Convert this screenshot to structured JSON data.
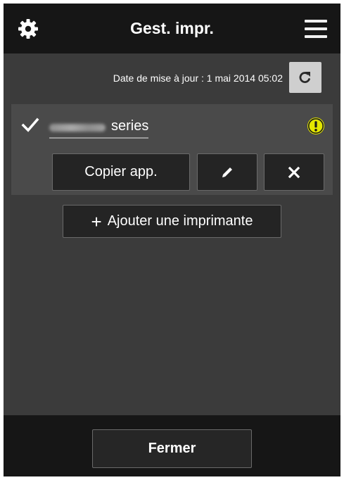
{
  "header": {
    "title": "Gest. impr.",
    "settings_icon": "gear-icon",
    "menu_icon": "hamburger-menu-icon"
  },
  "status": {
    "last_update": "Date de mise à jour : 1 mai 2014 05:02",
    "refresh_icon": "refresh-icon"
  },
  "printers": [
    {
      "selected": true,
      "model_hidden": "MG8800",
      "suffix": "series",
      "has_warning": true,
      "warning_icon": "warning-icon",
      "copy_label": "Copier app.",
      "edit_icon": "pencil-icon",
      "delete_icon": "close-icon"
    }
  ],
  "actions": {
    "add_printer_label": "Ajouter une imprimante",
    "add_icon": "plus-icon"
  },
  "footer": {
    "close_label": "Fermer"
  },
  "colors": {
    "header_bg": "#161616",
    "body_bg": "#3b3b3b",
    "card_bg": "#4a4a4a",
    "button_bg": "#242424",
    "warning": "#e3e600"
  }
}
